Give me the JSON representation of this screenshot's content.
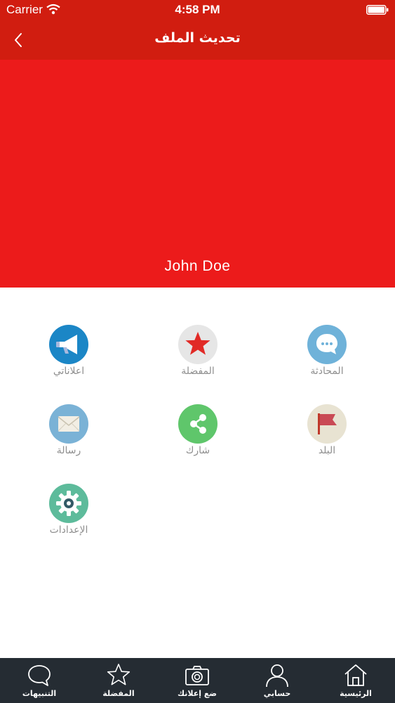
{
  "status_bar": {
    "carrier": "Carrier",
    "time": "4:58 PM"
  },
  "nav": {
    "title": "تحديث الملف"
  },
  "profile": {
    "name": "John Doe"
  },
  "menu": {
    "chat": "المحادثة",
    "favorites": "المفضلة",
    "my_ads": "اعلاناتي",
    "country": "البلد",
    "share": "شارك",
    "message": "رسالة",
    "settings": "الإعدادات"
  },
  "tabs": {
    "home": "الرئيسية",
    "account": "حسابي",
    "post_ad": "ضع إعلانك",
    "favorites": "المفضلة",
    "notifications": "التنبيهات"
  },
  "colors": {
    "nav_bar": "#d11d10",
    "header": "#ec1b1b",
    "tab_bar": "#252c33"
  }
}
